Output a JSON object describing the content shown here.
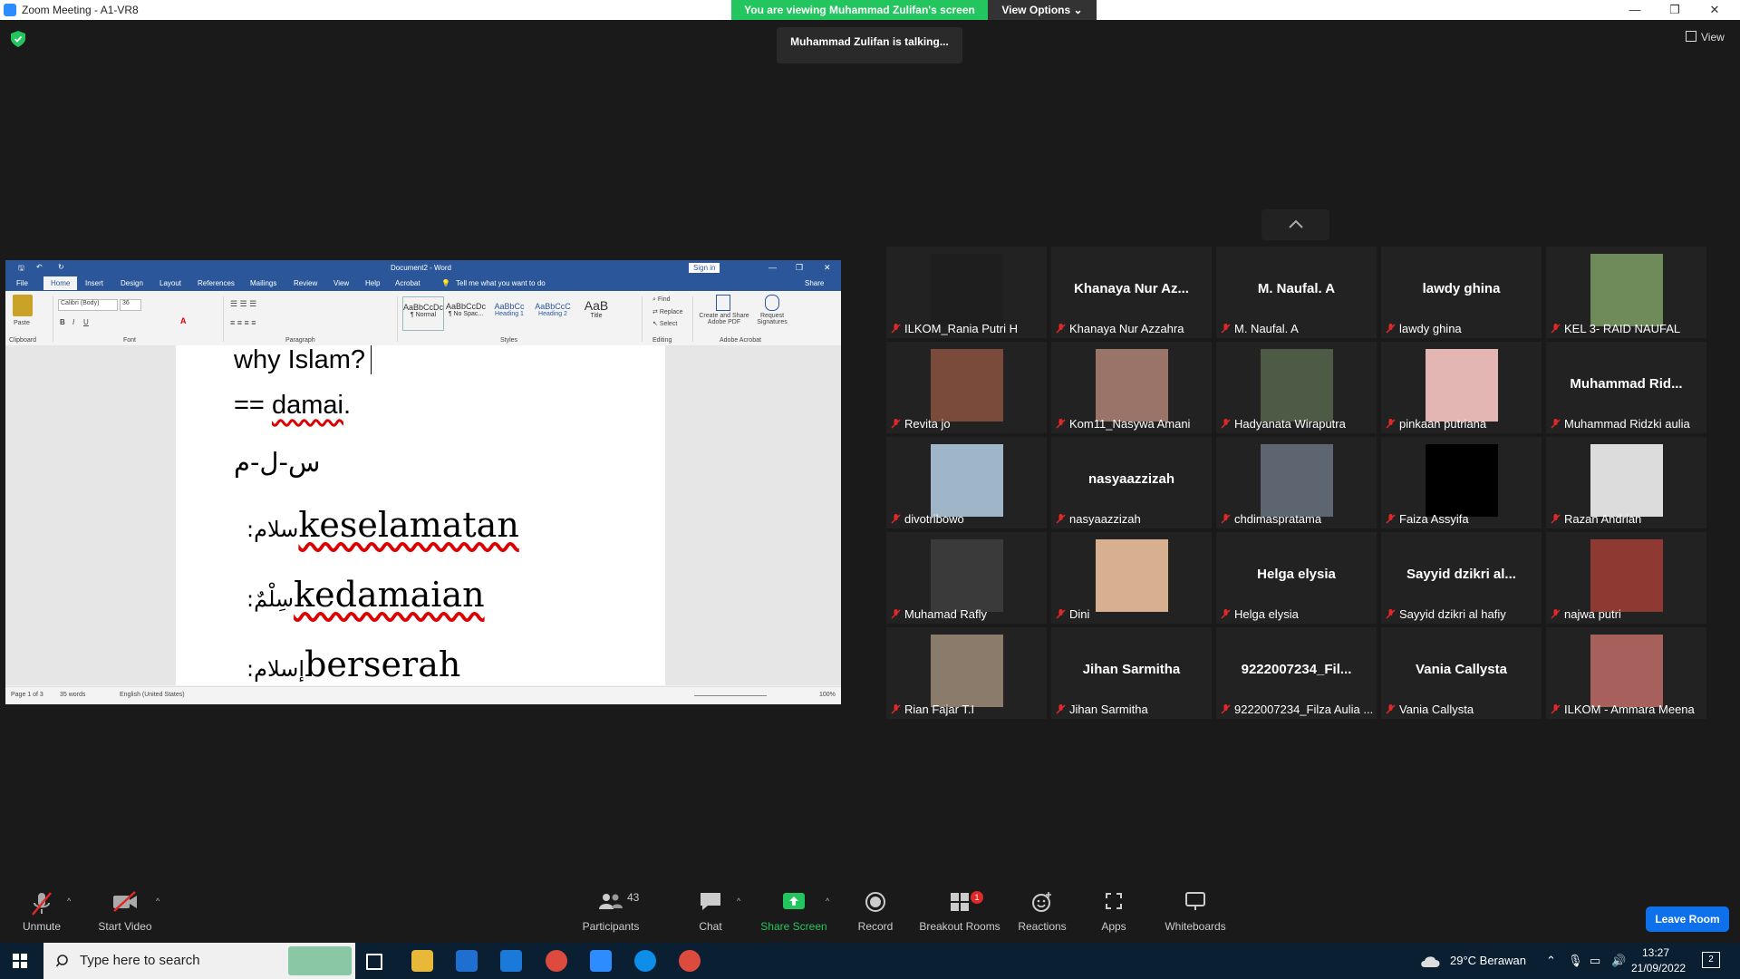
{
  "window": {
    "title": "Zoom Meeting - A1-VR8"
  },
  "banner": {
    "viewing": "You are viewing Muhammad Zulifan's screen",
    "view_options": "View Options"
  },
  "talking": "Muhammad Zulifan is talking...",
  "view_label": "View",
  "colors": {
    "green": "#23c55e",
    "zoom_blue": "#0e71eb",
    "word_blue": "#2b579a",
    "muted_red": "#e02828"
  },
  "word": {
    "title": "Document2 - Word",
    "sign_in": "Sign in",
    "tabs": [
      "File",
      "Home",
      "Insert",
      "Design",
      "Layout",
      "References",
      "Mailings",
      "Review",
      "View",
      "Help",
      "Acrobat"
    ],
    "tell_me": "Tell me what you want to do",
    "share": "Share",
    "paste": "Paste",
    "font_name": "Calibri (Body)",
    "font_size": "36",
    "styles": [
      {
        "sample": "AaBbCcDc",
        "name": "¶ Normal"
      },
      {
        "sample": "AaBbCcDc",
        "name": "¶ No Spac..."
      },
      {
        "sample": "AaBbCc",
        "name": "Heading 1"
      },
      {
        "sample": "AaBbCcC",
        "name": "Heading 2"
      },
      {
        "sample": "AaB",
        "name": "Title"
      }
    ],
    "editing": {
      "find": "Find",
      "replace": "Replace",
      "select": "Select"
    },
    "acrobat": {
      "create": "Create and Share Adobe PDF",
      "request": "Request Signatures"
    },
    "groups": {
      "clipboard": "Clipboard",
      "font": "Font",
      "paragraph": "Paragraph",
      "styles": "Styles",
      "editing": "Editing",
      "adobe": "Adobe Acrobat"
    },
    "doc_lines": {
      "l1": "why Islam?",
      "l2_prefix": "== ",
      "l2_word": "damai",
      "l2_suffix": ".",
      "l3": "س-ل-م",
      "l4_arabic": ":سلام",
      "l4_word": "keselamatan",
      "l5_arabic": ":سِلْمٌ",
      "l5_word": "kedamaian",
      "l6_arabic": ":إسلام",
      "l6_word": "berserah"
    },
    "status": {
      "page": "Page 1 of 3",
      "words": "35 words",
      "lang": "English (United States)",
      "zoom": "100%"
    }
  },
  "participants": [
    {
      "name": "ILKOM_Rania Putri H",
      "display": "",
      "has_photo": true,
      "color": "#1e1e1e"
    },
    {
      "name": "Khanaya Nur Azzahra",
      "display": "Khanaya Nur Az...",
      "has_photo": false
    },
    {
      "name": "M. Naufal. A",
      "display": "M. Naufal. A",
      "has_photo": false
    },
    {
      "name": "lawdy ghina",
      "display": "lawdy ghina",
      "has_photo": false
    },
    {
      "name": "KEL 3- RAID NAUFAL",
      "display": "",
      "has_photo": true,
      "color": "#6f8b5a"
    },
    {
      "name": "Revita jo",
      "display": "",
      "has_photo": true,
      "color": "#7a4a3a"
    },
    {
      "name": "Kom11_Nasywa Amani",
      "display": "",
      "has_photo": true,
      "color": "#9a7468"
    },
    {
      "name": "Hadyanata Wiraputra",
      "display": "",
      "has_photo": true,
      "color": "#4c5a46"
    },
    {
      "name": "pinkaan putriana",
      "display": "",
      "has_photo": true,
      "color": "#e3b6b3"
    },
    {
      "name": "Muhammad Ridzki aulia",
      "display": "Muhammad Rid...",
      "has_photo": false
    },
    {
      "name": "divotribowo",
      "display": "",
      "has_photo": true,
      "color": "#9fb6c9"
    },
    {
      "name": "nasyaazzizah",
      "display": "nasyaazzizah",
      "has_photo": false
    },
    {
      "name": "chdimaspratama",
      "display": "",
      "has_photo": true,
      "color": "#5d6670"
    },
    {
      "name": "Faiza Assyifa",
      "display": "",
      "has_photo": true,
      "color": "#000000"
    },
    {
      "name": "Razan Andrian",
      "display": "",
      "has_photo": true,
      "color": "#dcdcdc"
    },
    {
      "name": "Muhamad Rafly",
      "display": "",
      "has_photo": true,
      "color": "#3a3a3a"
    },
    {
      "name": "Dini",
      "display": "",
      "has_photo": true,
      "color": "#d8b08f"
    },
    {
      "name": "Helga elysia",
      "display": "Helga elysia",
      "has_photo": false
    },
    {
      "name": "Sayyid dzikri al hafiy",
      "display": "Sayyid dzikri al...",
      "has_photo": false
    },
    {
      "name": "najwa putri",
      "display": "",
      "has_photo": true,
      "color": "#8e3a32"
    },
    {
      "name": "Rian Fajar T.I",
      "display": "",
      "has_photo": true,
      "color": "#8a7b6a"
    },
    {
      "name": "Jihan Sarmitha",
      "display": "Jihan Sarmitha",
      "has_photo": false
    },
    {
      "name": "9222007234_Filza Aulia ...",
      "display": "9222007234_Fil...",
      "has_photo": false
    },
    {
      "name": "Vania Callysta",
      "display": "Vania Callysta",
      "has_photo": false
    },
    {
      "name": "ILKOM - Ammara Meena",
      "display": "",
      "has_photo": true,
      "color": "#a8605c"
    }
  ],
  "toolbar": {
    "unmute": "Unmute",
    "start_video": "Start Video",
    "participants": "Participants",
    "participants_count": "43",
    "chat": "Chat",
    "share_screen": "Share Screen",
    "record": "Record",
    "breakout_rooms": "Breakout Rooms",
    "breakout_badge": "1",
    "reactions": "Reactions",
    "apps": "Apps",
    "whiteboards": "Whiteboards",
    "leave": "Leave Room"
  },
  "taskbar": {
    "search_placeholder": "Type here to search",
    "weather": "29°C  Berawan",
    "time": "13:27",
    "date": "21/09/2022",
    "notif_count": "2"
  }
}
